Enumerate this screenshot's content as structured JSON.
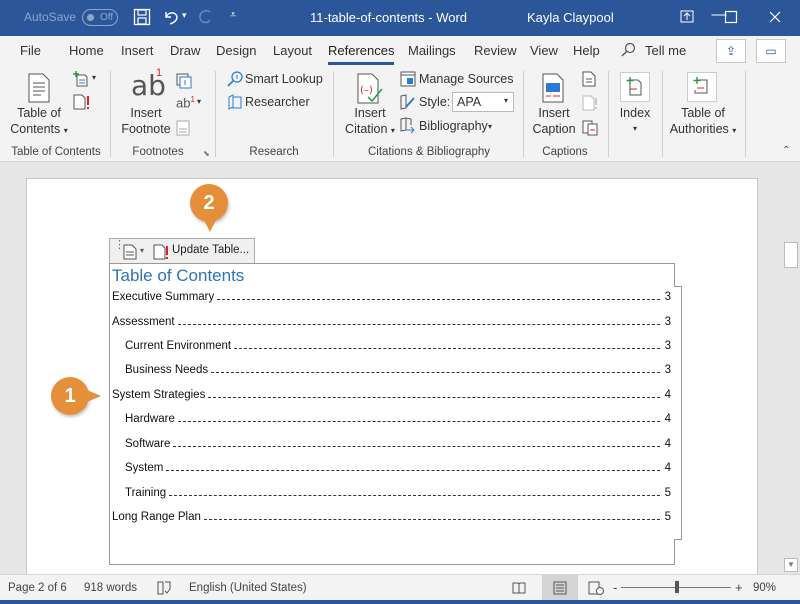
{
  "titlebar": {
    "autosave_label": "AutoSave",
    "autosave_state": "Off",
    "title": "11-table-of-contents - Word",
    "user": "Kayla Claypool"
  },
  "tabs": [
    {
      "label": "File"
    },
    {
      "label": "Home"
    },
    {
      "label": "Insert"
    },
    {
      "label": "Draw"
    },
    {
      "label": "Design"
    },
    {
      "label": "Layout"
    },
    {
      "label": "References",
      "active": true
    },
    {
      "label": "Mailings"
    },
    {
      "label": "Review"
    },
    {
      "label": "View"
    },
    {
      "label": "Help"
    }
  ],
  "tellme": "Tell me",
  "ribbon": {
    "toc": {
      "btn_line1": "Table of",
      "btn_line2": "Contents",
      "group": "Table of Contents"
    },
    "footnotes": {
      "btn_line1": "Insert",
      "btn_line2": "Footnote",
      "ab": "ab",
      "sup": "1",
      "group": "Footnotes"
    },
    "research": {
      "smart_lookup": "Smart Lookup",
      "researcher": "Researcher",
      "group": "Research"
    },
    "citations": {
      "btn_line1": "Insert",
      "btn_line2": "Citation",
      "manage_sources": "Manage Sources",
      "style_label": "Style:",
      "style_value": "APA",
      "bibliography": "Bibliography",
      "group": "Citations & Bibliography"
    },
    "captions": {
      "btn_line1": "Insert",
      "btn_line2": "Caption",
      "group": "Captions"
    },
    "index": {
      "btn_line1": "Index"
    },
    "authorities": {
      "btn_line1": "Table of",
      "btn_line2": "Authorities"
    }
  },
  "document": {
    "update_table": "Update Table...",
    "toc_heading": "Table of Contents",
    "entries": [
      {
        "text": "Executive Summary",
        "page": "3",
        "level": 1
      },
      {
        "text": "Assessment",
        "page": "3",
        "level": 1
      },
      {
        "text": "Current Environment",
        "page": "3",
        "level": 2
      },
      {
        "text": "Business Needs",
        "page": "3",
        "level": 2
      },
      {
        "text": "System Strategies",
        "page": "4",
        "level": 1
      },
      {
        "text": "Hardware",
        "page": "4",
        "level": 2
      },
      {
        "text": "Software",
        "page": "4",
        "level": 2
      },
      {
        "text": "System",
        "page": "4",
        "level": 2
      },
      {
        "text": "Training",
        "page": "5",
        "level": 2
      },
      {
        "text": "Long Range Plan",
        "page": "5",
        "level": 1
      }
    ]
  },
  "callouts": [
    "1",
    "2"
  ],
  "status": {
    "page": "Page 2 of 6",
    "words": "918 words",
    "language": "English (United States)",
    "zoom": "90%",
    "zoom_minus": "-",
    "zoom_plus": "+"
  },
  "colors": {
    "accent": "#2b579a",
    "callout": "#e58f3a",
    "toc_heading": "#2e74b5"
  }
}
